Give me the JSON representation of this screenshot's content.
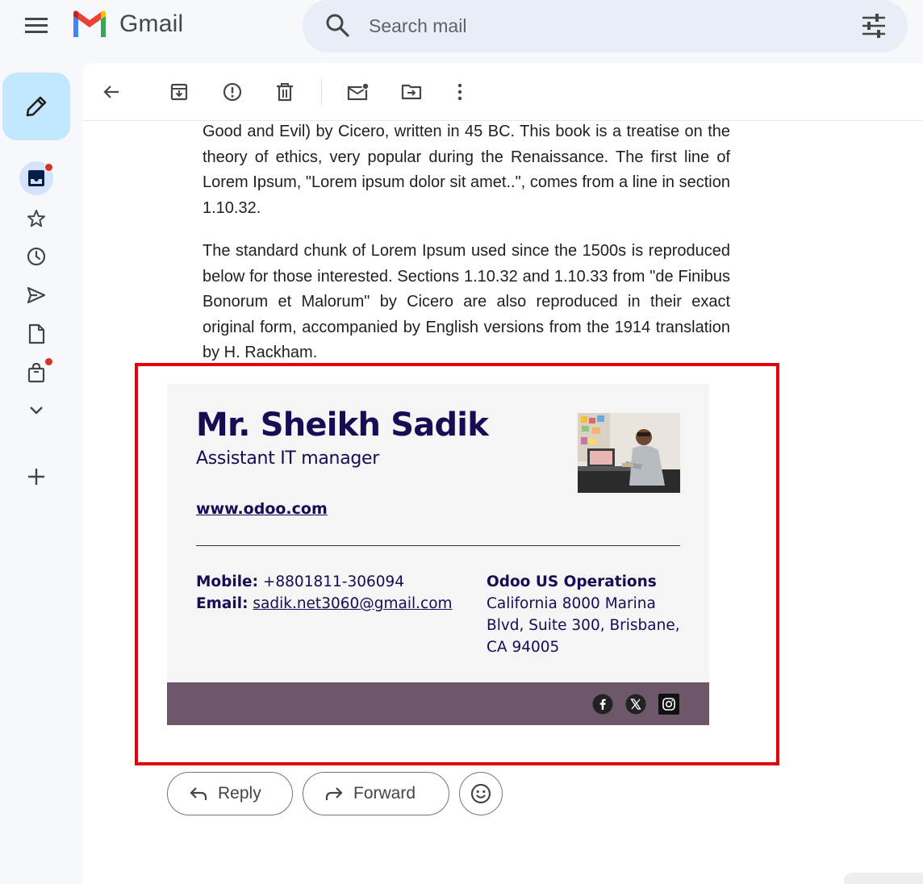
{
  "app": {
    "name": "Gmail"
  },
  "search": {
    "placeholder": "Search mail"
  },
  "email": {
    "paragraph_1": "Good and Evil) by Cicero, written in 45 BC. This book is a treatise on the theory of ethics, very popular during the Renaissance. The first line of Lorem Ipsum, \"Lorem ipsum dolor sit amet..\", comes from a line in section 1.10.32.",
    "paragraph_2": "The standard chunk of Lorem Ipsum used since the 1500s is reproduced below for those interested. Sections 1.10.32 and 1.10.33 from \"de Finibus Bonorum et Malorum\" by Cicero are also reproduced in their exact original form, accompanied by English versions from the 1914 translation by H. Rackham."
  },
  "signature": {
    "name": "Mr. Sheikh Sadik",
    "title": "Assistant IT manager",
    "website": "www.odoo.com",
    "mobile_label": "Mobile:",
    "mobile": "+8801811-306094",
    "email_label": "Email:",
    "email": "sadik.net3060@gmail.com",
    "company": "Odoo US Operations",
    "address_line1": "California 8000 Marina",
    "address_line2": "Blvd, Suite 300, Brisbane,",
    "address_line3": "CA 94005",
    "social_icons": [
      "facebook-icon",
      "x-twitter-icon",
      "instagram-icon"
    ]
  },
  "actions": {
    "reply": "Reply",
    "forward": "Forward"
  },
  "colors": {
    "signature_text": "#180c55",
    "signature_footer": "#6d5768",
    "highlight_border": "#e5000b",
    "compose_bg": "#c2e7ff",
    "notification_dot": "#d93025"
  }
}
